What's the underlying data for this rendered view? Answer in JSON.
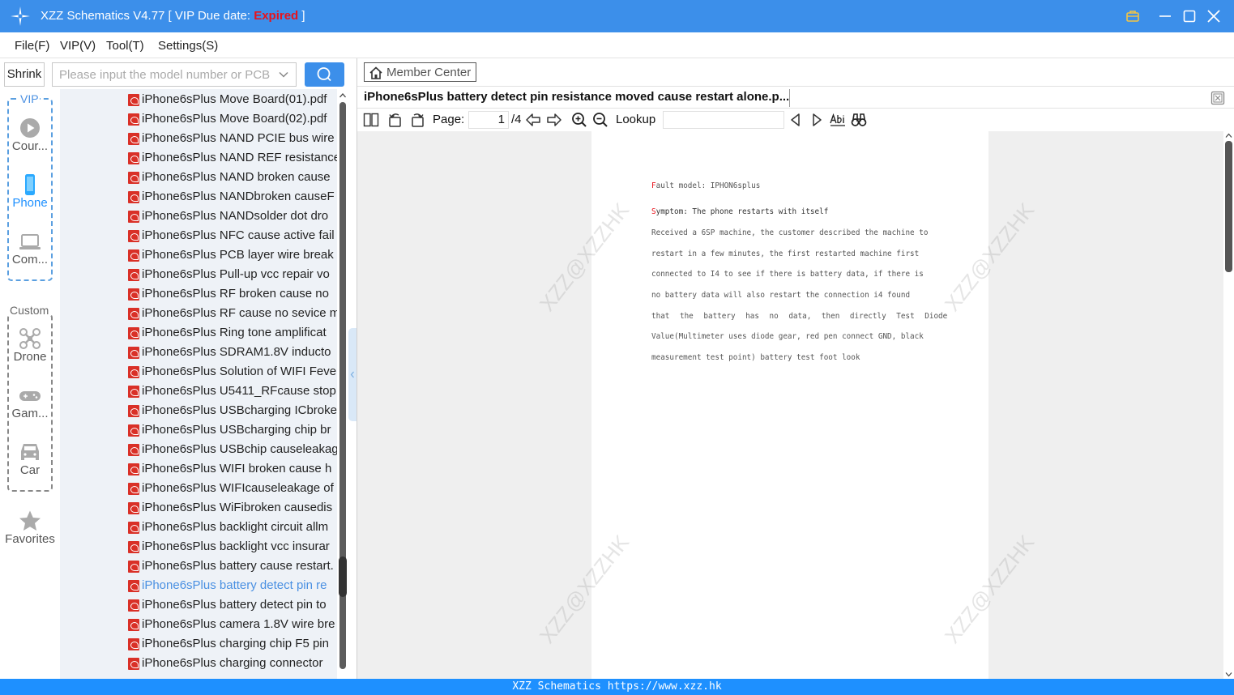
{
  "titlebar": {
    "title_prefix": "XZZ Schematics V4.77 [ VIP Due date: ",
    "expired": "Expired",
    "title_suffix": " ]"
  },
  "menu": [
    "File(F)",
    "VIP(V)",
    "Tool(T)",
    "Settings(S)"
  ],
  "search": {
    "shrink_label": "Shrink",
    "placeholder": "Please input the model number or PCB"
  },
  "categories": {
    "vip_label": "VIP",
    "custom_label": "Custom",
    "vip_items": [
      {
        "label": "Cour...",
        "icon": "play-circle-icon"
      },
      {
        "label": "Phone",
        "icon": "phone-icon"
      },
      {
        "label": "Com...",
        "icon": "laptop-icon"
      }
    ],
    "custom_items": [
      {
        "label": "Drone",
        "icon": "drone-icon"
      },
      {
        "label": "Gam...",
        "icon": "gamepad-icon"
      },
      {
        "label": "Car",
        "icon": "car-icon"
      }
    ],
    "favorites_label": "Favorites"
  },
  "files": [
    "iPhone6sPlus Move Board(01).pdf",
    "iPhone6sPlus Move Board(02).pdf",
    "iPhone6sPlus NAND PCIE bus wire",
    "iPhone6sPlus NAND REF resistance",
    "iPhone6sPlus NAND broken cause",
    "iPhone6sPlus NANDbroken causeF",
    "iPhone6sPlus NANDsolder dot dro",
    "iPhone6sPlus NFC cause active fail",
    "iPhone6sPlus PCB layer wire break",
    "iPhone6sPlus Pull-up vcc repair vo",
    "iPhone6sPlus RF broken cause no",
    "iPhone6sPlus RF cause no sevice m",
    "iPhone6sPlus Ring tone amplificat",
    "iPhone6sPlus SDRAM1.8V inducto",
    "iPhone6sPlus Solution of WIFI Feve",
    "iPhone6sPlus U5411_RFcause stop",
    "iPhone6sPlus USBcharging ICbroke",
    "iPhone6sPlus USBcharging chip br",
    "iPhone6sPlus USBchip causeleakag",
    "iPhone6sPlus WIFI broken cause h",
    "iPhone6sPlus WIFIcauseleakage of",
    "iPhone6sPlus WiFibroken causedis",
    "iPhone6sPlus backlight circuit allm",
    "iPhone6sPlus backlight vcc insurar",
    "iPhone6sPlus battery cause restart.",
    "iPhone6sPlus battery detect pin re",
    "iPhone6sPlus battery detect pin to",
    "iPhone6sPlus camera 1.8V wire bre",
    "iPhone6sPlus charging chip F5 pin",
    "iPhone6sPlus charging connector"
  ],
  "selected_file_index": 25,
  "viewer": {
    "member_center": "Member Center",
    "tab_title": "iPhone6sPlus battery detect pin resistance moved cause restart alone.p...",
    "page_label": "Page:",
    "page_current": "1",
    "page_total": "/4",
    "lookup_label": "Lookup"
  },
  "document": {
    "fault_first": "F",
    "fault_rest": "ault model: IPHON6splus",
    "symptom_first": "S",
    "symptom_rest": "ymptom: The phone restarts with itself",
    "body_lines": [
      "Received a 6SP machine, the customer described the machine to",
      "restart in a few minutes, the first restarted machine first",
      "connected to I4 to see if there is battery data, if there is",
      "no battery data will also restart the connection i4 found",
      "that the battery has no data, then directly Test Diode",
      "Value(Multimeter uses diode gear, red pen connect GND, black",
      "measurement test point) battery test foot look"
    ],
    "watermark": "XZZ@XZZHK"
  },
  "statusbar": "XZZ Schematics https://www.xzz.hk",
  "colors": {
    "titlebar": "#3c8fea",
    "accent": "#1e90ff",
    "expired": "#e8131b",
    "pdf_icon": "#d93027"
  }
}
